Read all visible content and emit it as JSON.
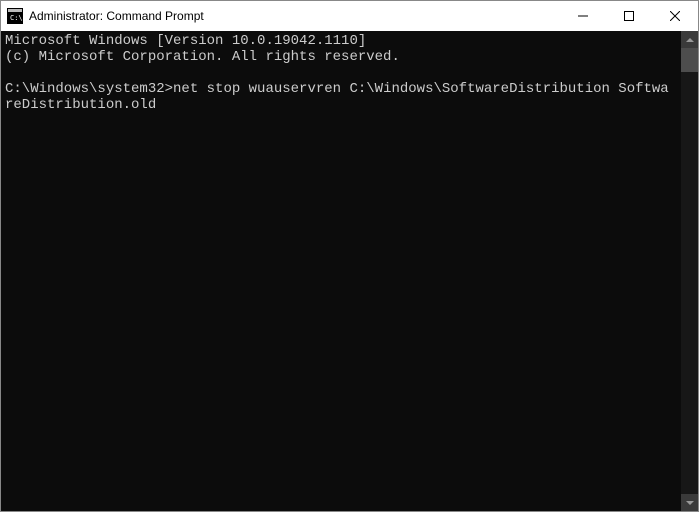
{
  "window": {
    "title": "Administrator: Command Prompt"
  },
  "console": {
    "line1": "Microsoft Windows [Version 10.0.19042.1110]",
    "line2": "(c) Microsoft Corporation. All rights reserved.",
    "blank": "",
    "prompt": "C:\\Windows\\system32>",
    "command": "net stop wuauservren C:\\Windows\\SoftwareDistribution SoftwareDistribution.old"
  }
}
